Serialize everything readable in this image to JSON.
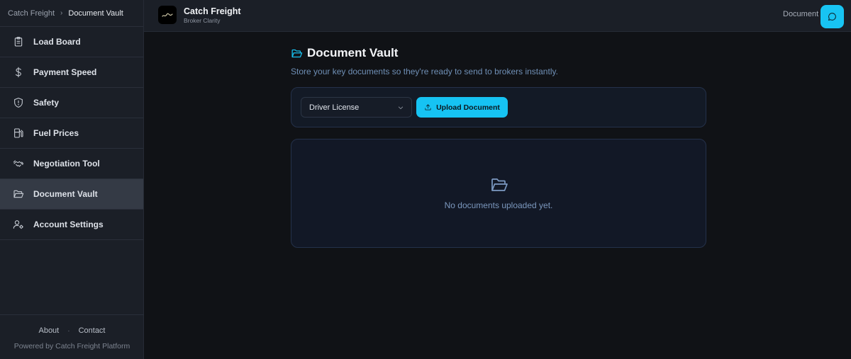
{
  "breadcrumb": {
    "root": "Catch Freight",
    "current": "Document Vault"
  },
  "sidebar": {
    "items": [
      {
        "label": "Load Board",
        "icon": "clipboard-icon"
      },
      {
        "label": "Payment Speed",
        "icon": "dollar-icon"
      },
      {
        "label": "Safety",
        "icon": "shield-icon"
      },
      {
        "label": "Fuel Prices",
        "icon": "fuel-pump-icon"
      },
      {
        "label": "Negotiation Tool",
        "icon": "handshake-icon"
      },
      {
        "label": "Document Vault",
        "icon": "folder-open-icon",
        "active": true
      },
      {
        "label": "Account Settings",
        "icon": "user-gear-icon"
      }
    ],
    "footer": {
      "about": "About",
      "contact": "Contact",
      "powered": "Powered by Catch Freight Platform"
    }
  },
  "topbar": {
    "title": "Catch Freight",
    "subtitle": "Broker Clarity",
    "right_label": "Document",
    "accent": "#18c4f3"
  },
  "main": {
    "title": "Document Vault",
    "subtitle": "Store your key documents so they're ready to send to brokers instantly.",
    "select_value": "Driver License",
    "upload_label": "Upload Document",
    "empty_text": "No documents uploaded yet."
  }
}
